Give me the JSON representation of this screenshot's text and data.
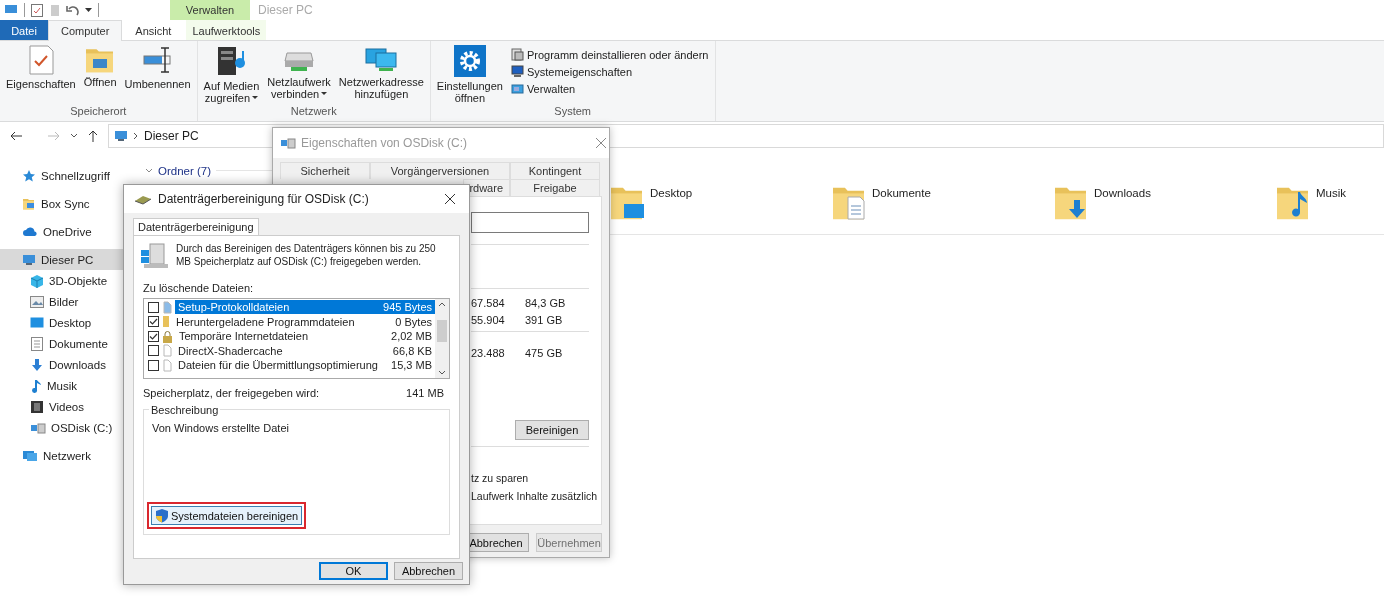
{
  "title_bar": {
    "context_group": "Verwalten",
    "title": "Dieser PC"
  },
  "ribbon_tabs": [
    {
      "label": "Datei",
      "kind": "file",
      "selected": false
    },
    {
      "label": "Computer",
      "kind": "tab",
      "selected": true
    },
    {
      "label": "Ansicht",
      "kind": "tab",
      "selected": false
    },
    {
      "label": "Laufwerktools",
      "kind": "context",
      "selected": false
    }
  ],
  "ribbon_groups": [
    {
      "label": "Speicherort",
      "buttons": [
        {
          "label": "Eigenschaften",
          "kind": "large",
          "has_menu": false
        },
        {
          "label": "Öffnen",
          "kind": "large",
          "has_menu": false
        },
        {
          "label": "Umbenennen",
          "kind": "large",
          "has_menu": false
        }
      ]
    },
    {
      "label": "Netzwerk",
      "buttons": [
        {
          "label": "Auf Medien\nzugreifen",
          "kind": "large",
          "has_menu": true
        },
        {
          "label": "Netzlaufwerk\nverbinden",
          "kind": "large",
          "has_menu": true
        },
        {
          "label": "Netzwerkadresse\nhinzufügen",
          "kind": "large",
          "has_menu": false
        }
      ]
    },
    {
      "label": "System",
      "buttons": [
        {
          "label": "Einstellungen\nöffnen",
          "kind": "large",
          "has_menu": false
        },
        {
          "label": "Programm deinstallieren oder ändern",
          "kind": "small",
          "has_menu": false
        },
        {
          "label": "Systemeigenschaften",
          "kind": "small",
          "has_menu": false
        },
        {
          "label": "Verwalten",
          "kind": "small",
          "has_menu": false
        }
      ]
    }
  ],
  "address_bar": {
    "path": "Dieser PC"
  },
  "sidebar": [
    {
      "label": "Schnellzugriff",
      "selected": false
    },
    {
      "label": "Box Sync",
      "selected": false
    },
    {
      "label": "OneDrive",
      "selected": false
    },
    {
      "label": "Dieser PC",
      "selected": true,
      "children": [
        {
          "label": "3D-Objekte",
          "selected": false
        },
        {
          "label": "Bilder",
          "selected": false
        },
        {
          "label": "Desktop",
          "selected": false
        },
        {
          "label": "Dokumente",
          "selected": false
        },
        {
          "label": "Downloads",
          "selected": false
        },
        {
          "label": "Musik",
          "selected": false
        },
        {
          "label": "Videos",
          "selected": false
        },
        {
          "label": "OSDisk (C:)",
          "selected": false
        }
      ]
    },
    {
      "label": "Netzwerk",
      "selected": false
    }
  ],
  "content": {
    "group": "Ordner (7)",
    "folders": [
      {
        "label": "Desktop"
      },
      {
        "label": "Dokumente"
      },
      {
        "label": "Downloads"
      },
      {
        "label": "Musik"
      }
    ]
  },
  "properties_dialog": {
    "title": "Eigenschaften von OSDisk (C:)",
    "tabs_row_1": [
      {
        "label": "Sicherheit",
        "selected": false
      },
      {
        "label": "Vorgängerversionen",
        "selected": false
      },
      {
        "label": "Kontingent",
        "selected": false
      }
    ],
    "tabs_row_2": [
      {
        "label": "rdware",
        "selected": false
      },
      {
        "label": "Freigabe",
        "selected": false
      }
    ],
    "stats": [
      {
        "column_1": "67.584",
        "column_2": "84,3 GB"
      },
      {
        "column_1": "55.904",
        "column_2": "391 GB"
      },
      {
        "column_1": "23.488",
        "column_2": "475 GB"
      }
    ],
    "clean_button": "Bereinigen",
    "options": [
      "tz zu sparen",
      "Laufwerk Inhalte zusätzlich"
    ],
    "buttons": [
      {
        "label": "Abbrechen",
        "disabled": false
      },
      {
        "label": "Übernehmen",
        "disabled": true
      }
    ]
  },
  "cleanup_dialog": {
    "title": "Datenträgerbereinigung für OSDisk (C:)",
    "tab": "Datenträgerbereinigung",
    "intro": "Durch das Bereinigen des Datenträgers können bis zu 250 MB Speicherplatz auf OSDisk (C:) freigegeben werden.",
    "files_label": "Zu löschende Dateien:",
    "files": [
      {
        "name": "Setup-Protokolldateien",
        "size": "945 Bytes",
        "checked": false,
        "selected": true
      },
      {
        "name": "Heruntergeladene Programmdateien",
        "size": "0 Bytes",
        "checked": true,
        "selected": false
      },
      {
        "name": "Temporäre Internetdateien",
        "size": "2,02 MB",
        "checked": true,
        "selected": false
      },
      {
        "name": "DirectX-Shadercache",
        "size": "66,8 KB",
        "checked": false,
        "selected": false
      },
      {
        "name": "Dateien für die Übermittlungsoptimierung",
        "size": "15,3 MB",
        "checked": false,
        "selected": false
      }
    ],
    "space_label": "Speicherplatz, der freigegeben wird:",
    "space_value": "141 MB",
    "description_group": "Beschreibung",
    "description": "Von Windows erstellte Datei",
    "system_button": {
      "label": "Systemdateien bereinigen",
      "highlighted": true
    },
    "buttons": [
      {
        "label": "OK",
        "default": true
      },
      {
        "label": "Abbrechen",
        "default": false
      }
    ]
  }
}
